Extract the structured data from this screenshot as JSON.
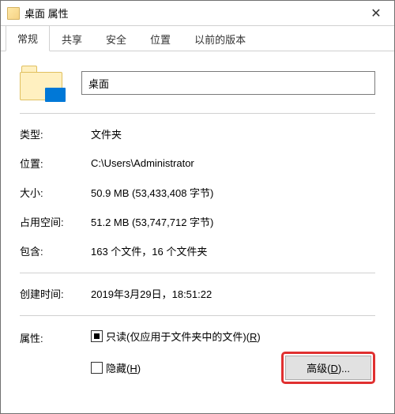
{
  "window": {
    "title": "桌面 属性"
  },
  "tabs": [
    {
      "label": "常规"
    },
    {
      "label": "共享"
    },
    {
      "label": "安全"
    },
    {
      "label": "位置"
    },
    {
      "label": "以前的版本"
    }
  ],
  "folder": {
    "name": "桌面"
  },
  "props": {
    "type_label": "类型:",
    "type_value": "文件夹",
    "location_label": "位置:",
    "location_value": "C:\\Users\\Administrator",
    "size_label": "大小:",
    "size_value": "50.9 MB (53,433,408 字节)",
    "sizeondisk_label": "占用空间:",
    "sizeondisk_value": "51.2 MB (53,747,712 字节)",
    "contains_label": "包含:",
    "contains_value": "163 个文件，16 个文件夹",
    "created_label": "创建时间:",
    "created_value": "2019年3月29日，18:51:22"
  },
  "attributes": {
    "label": "属性:",
    "readonly_prefix": "只读(仅应用于文件夹中的文件)(",
    "readonly_hotkey": "R",
    "readonly_suffix": ")",
    "hidden_prefix": "隐藏(",
    "hidden_hotkey": "H",
    "hidden_suffix": ")",
    "advanced_prefix": "高级(",
    "advanced_hotkey": "D",
    "advanced_suffix": ")..."
  }
}
